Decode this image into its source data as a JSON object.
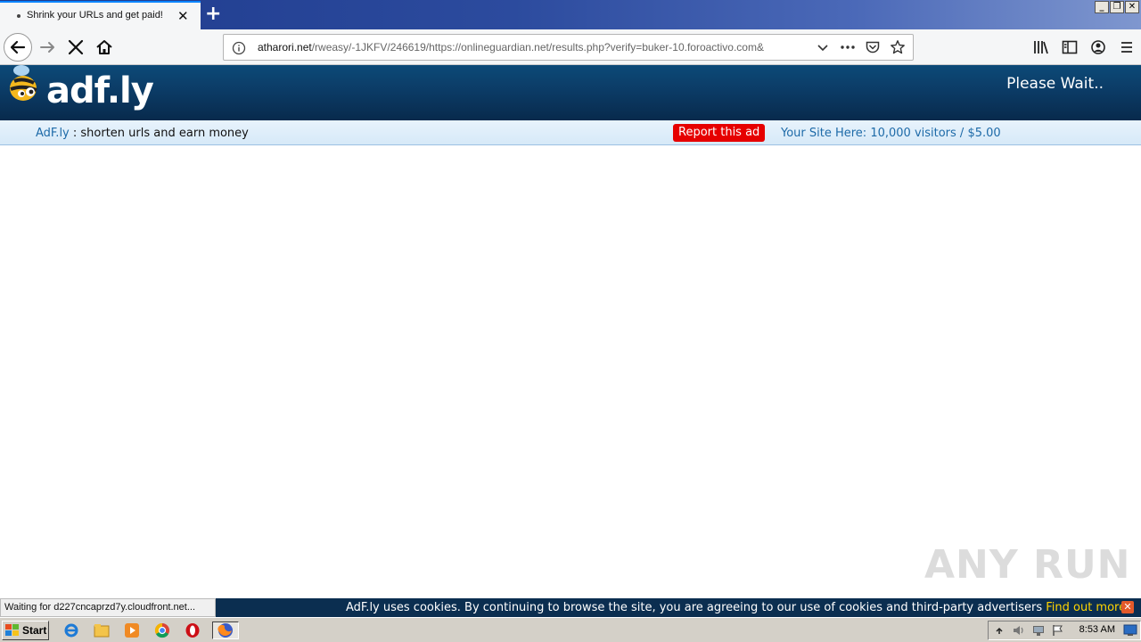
{
  "browser": {
    "tab_title": "Shrink your URLs and get paid!",
    "tab_close": "✕",
    "new_tab": "+",
    "url_host": "atharori.net",
    "url_path": "/rweasy/-1JKFV/246619/https://onlineguardian.net/results.php?verify=buker-10.foroactivo.com&",
    "status_text": "Waiting for d227cncaprzd7y.cloudfront.net..."
  },
  "window_buttons": {
    "minimize": "_",
    "restore": "❐",
    "close": "✕"
  },
  "header": {
    "logo_text": "adf.ly",
    "please_wait": "Please Wait.."
  },
  "subbar": {
    "brand_link": "AdF.ly",
    "tagline": " : shorten urls and earn money",
    "report_ad": "Report this ad",
    "your_site": "Your Site Here: 10,000 visitors / $5.00"
  },
  "cookie": {
    "text": "AdF.ly uses cookies. By continuing to browse the site, you are agreeing to our use of cookies and third-party advertisers ",
    "link": "Find out more.",
    "close": "✕"
  },
  "watermark": "ANY RUN",
  "taskbar": {
    "start_label": "Start",
    "clock": "8:53 AM"
  },
  "colors": {
    "header_bg": "#0b3a64",
    "report_red": "#e60000",
    "link_blue": "#1d6aa8",
    "cookie_bg": "#0b2e50",
    "cookie_link": "#ffd400"
  }
}
